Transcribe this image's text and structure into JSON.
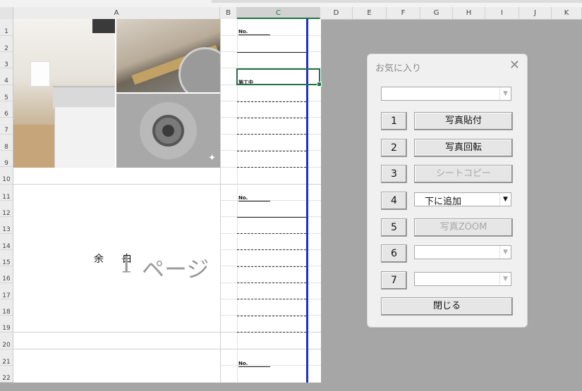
{
  "columns": [
    "A",
    "B",
    "C",
    "D",
    "E",
    "F",
    "G",
    "H",
    "I",
    "J",
    "K"
  ],
  "rows": [
    "1",
    "2",
    "3",
    "4",
    "5",
    "6",
    "7",
    "8",
    "9",
    "10",
    "11",
    "12",
    "13",
    "14",
    "15",
    "16",
    "17",
    "18",
    "19",
    "20",
    "21",
    "22"
  ],
  "sheet": {
    "no_label": "No.",
    "work_label": "施工中",
    "blank_text": "余白",
    "watermark_num": "1",
    "watermark_text": "ページ"
  },
  "dialog": {
    "title": "お気に入り",
    "close_icon": "close-icon",
    "numbers": [
      "1",
      "2",
      "3",
      "4",
      "5",
      "6",
      "7"
    ],
    "paste_photo": "写真貼付",
    "rotate_photo": "写真回転",
    "sheet_copy": "シートコピー",
    "add_below": "下に追加",
    "photo_zoom": "写真ZOOM",
    "close_button": "閉じる"
  },
  "colors": {
    "selection": "#217346",
    "page_border": "#1f2fcf",
    "disabled_text": "#a8a8a8"
  }
}
